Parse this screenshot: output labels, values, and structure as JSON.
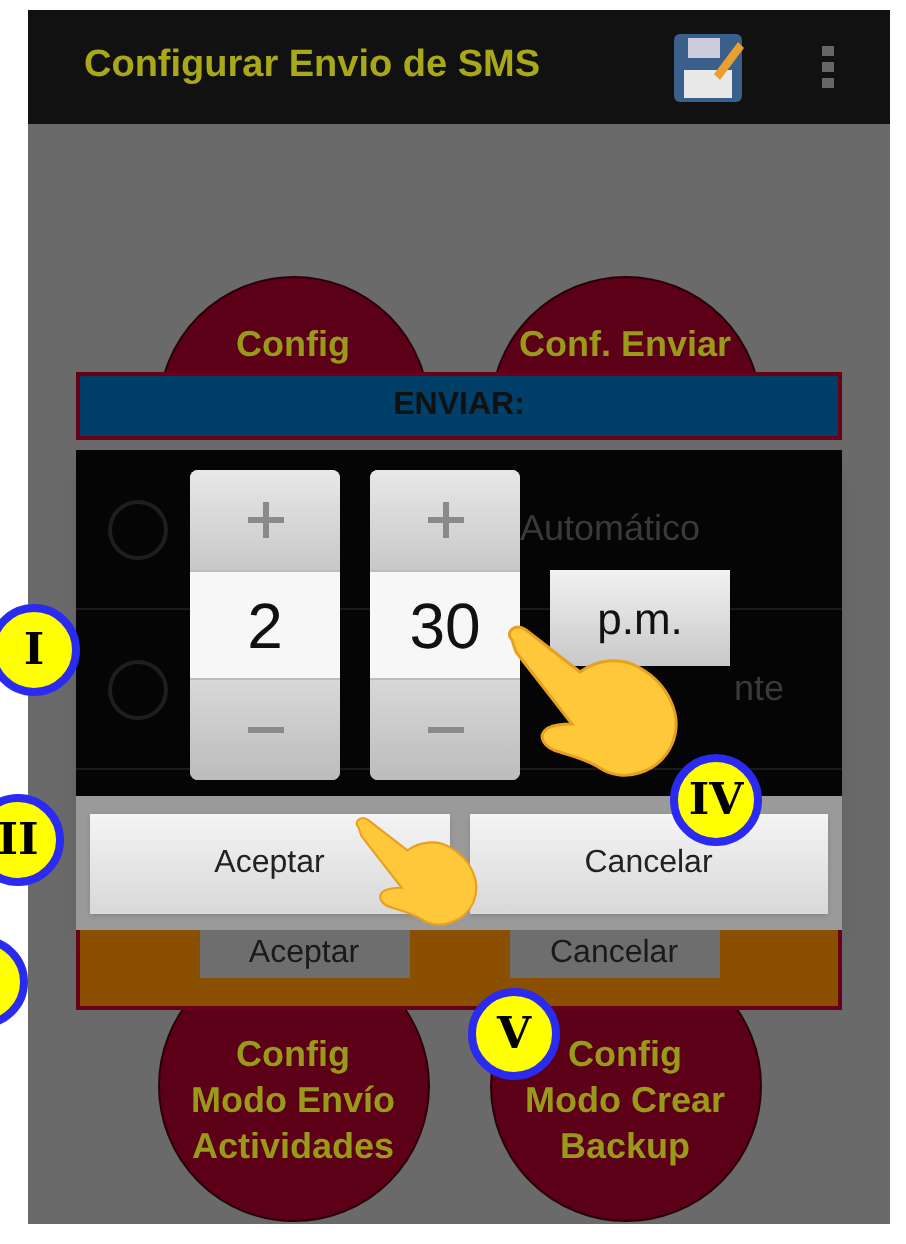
{
  "app_bar": {
    "title": "Configurar Envio de SMS"
  },
  "top_buttons": [
    "Config",
    "Conf. Enviar"
  ],
  "section_header": "ENVIAR:",
  "options": [
    {
      "label": "Automático",
      "selected": false
    },
    {
      "label": "nte",
      "selected": false
    }
  ],
  "time_picker": {
    "hour": "2",
    "minute": "30",
    "period": "p.m."
  },
  "dialog_buttons": [
    "Aceptar",
    "Cancelar"
  ],
  "panel_buttons": [
    "Aceptar",
    "Cancelar"
  ],
  "bottom_buttons": [
    [
      "Config",
      "Modo Envío",
      "Actividades"
    ],
    [
      "Config",
      "Modo Crear",
      "Backup"
    ]
  ],
  "step_badges": [
    "I",
    "II",
    "IV",
    "V"
  ]
}
